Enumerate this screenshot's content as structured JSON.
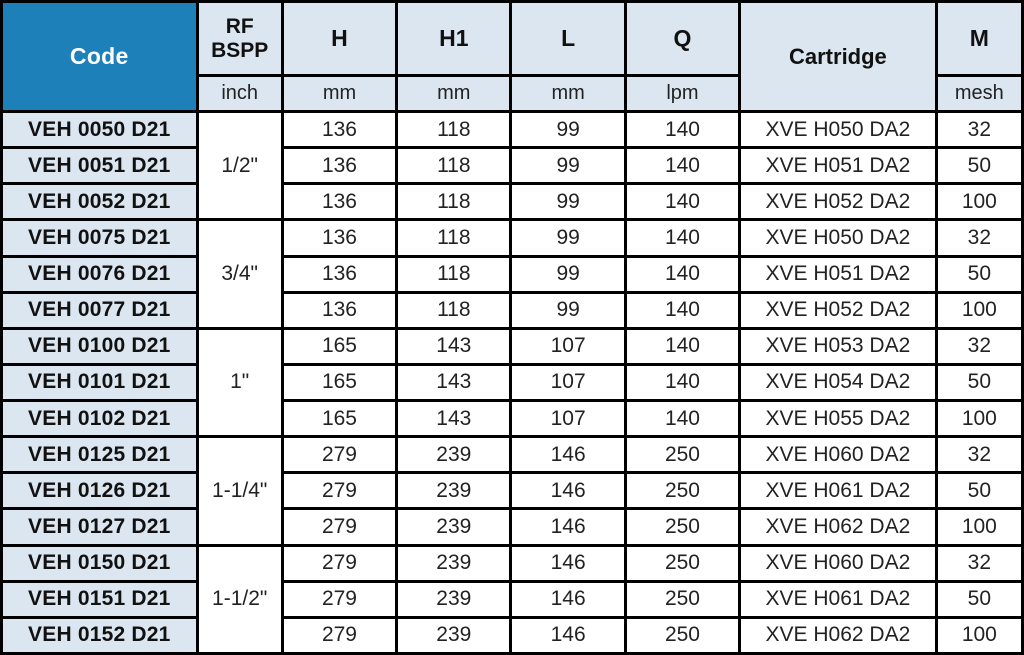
{
  "table": {
    "headers": {
      "code": "Code",
      "rf_bspp": "RF\nBSPP",
      "rf_bspp_line1": "RF",
      "rf_bspp_line2": "BSPP",
      "h": "H",
      "h1": "H1",
      "l": "L",
      "q": "Q",
      "cartridge": "Cartridge",
      "m": "M"
    },
    "units": {
      "code": "",
      "rf_bspp": "inch",
      "h": "mm",
      "h1": "mm",
      "l": "mm",
      "q": "lpm",
      "cartridge": "",
      "m": "mesh"
    },
    "colors": {
      "code_header_bg": "#1E80B8",
      "code_header_text": "#FFFFFF",
      "header_bg": "#DCE6F1",
      "code_cell_bg": "#DCE6F1",
      "cell_bg": "#FFFFFF",
      "border": "#000000",
      "text": "#222222"
    },
    "groups": [
      {
        "size": "1/2\"",
        "rows": [
          {
            "code": "VEH 0050 D21",
            "h": "136",
            "h1": "118",
            "l": "99",
            "q": "140",
            "cartridge": "XVE H050 DA2",
            "m": "32"
          },
          {
            "code": "VEH 0051 D21",
            "h": "136",
            "h1": "118",
            "l": "99",
            "q": "140",
            "cartridge": "XVE H051 DA2",
            "m": "50"
          },
          {
            "code": "VEH 0052 D21",
            "h": "136",
            "h1": "118",
            "l": "99",
            "q": "140",
            "cartridge": "XVE H052 DA2",
            "m": "100"
          }
        ]
      },
      {
        "size": "3/4\"",
        "rows": [
          {
            "code": "VEH 0075 D21",
            "h": "136",
            "h1": "118",
            "l": "99",
            "q": "140",
            "cartridge": "XVE H050 DA2",
            "m": "32"
          },
          {
            "code": "VEH 0076 D21",
            "h": "136",
            "h1": "118",
            "l": "99",
            "q": "140",
            "cartridge": "XVE H051 DA2",
            "m": "50"
          },
          {
            "code": "VEH 0077 D21",
            "h": "136",
            "h1": "118",
            "l": "99",
            "q": "140",
            "cartridge": "XVE H052 DA2",
            "m": "100"
          }
        ]
      },
      {
        "size": "1\"",
        "rows": [
          {
            "code": "VEH 0100 D21",
            "h": "165",
            "h1": "143",
            "l": "107",
            "q": "140",
            "cartridge": "XVE H053 DA2",
            "m": "32"
          },
          {
            "code": "VEH 0101 D21",
            "h": "165",
            "h1": "143",
            "l": "107",
            "q": "140",
            "cartridge": "XVE H054 DA2",
            "m": "50"
          },
          {
            "code": "VEH 0102 D21",
            "h": "165",
            "h1": "143",
            "l": "107",
            "q": "140",
            "cartridge": "XVE H055 DA2",
            "m": "100"
          }
        ]
      },
      {
        "size": "1-1/4\"",
        "rows": [
          {
            "code": "VEH 0125 D21",
            "h": "279",
            "h1": "239",
            "l": "146",
            "q": "250",
            "cartridge": "XVE H060 DA2",
            "m": "32"
          },
          {
            "code": "VEH 0126 D21",
            "h": "279",
            "h1": "239",
            "l": "146",
            "q": "250",
            "cartridge": "XVE H061 DA2",
            "m": "50"
          },
          {
            "code": "VEH 0127 D21",
            "h": "279",
            "h1": "239",
            "l": "146",
            "q": "250",
            "cartridge": "XVE H062 DA2",
            "m": "100"
          }
        ]
      },
      {
        "size": "1-1/2\"",
        "rows": [
          {
            "code": "VEH 0150 D21",
            "h": "279",
            "h1": "239",
            "l": "146",
            "q": "250",
            "cartridge": "XVE H060 DA2",
            "m": "32"
          },
          {
            "code": "VEH 0151 D21",
            "h": "279",
            "h1": "239",
            "l": "146",
            "q": "250",
            "cartridge": "XVE H061 DA2",
            "m": "50"
          },
          {
            "code": "VEH 0152 D21",
            "h": "279",
            "h1": "239",
            "l": "146",
            "q": "250",
            "cartridge": "XVE H062 DA2",
            "m": "100"
          }
        ]
      }
    ]
  }
}
